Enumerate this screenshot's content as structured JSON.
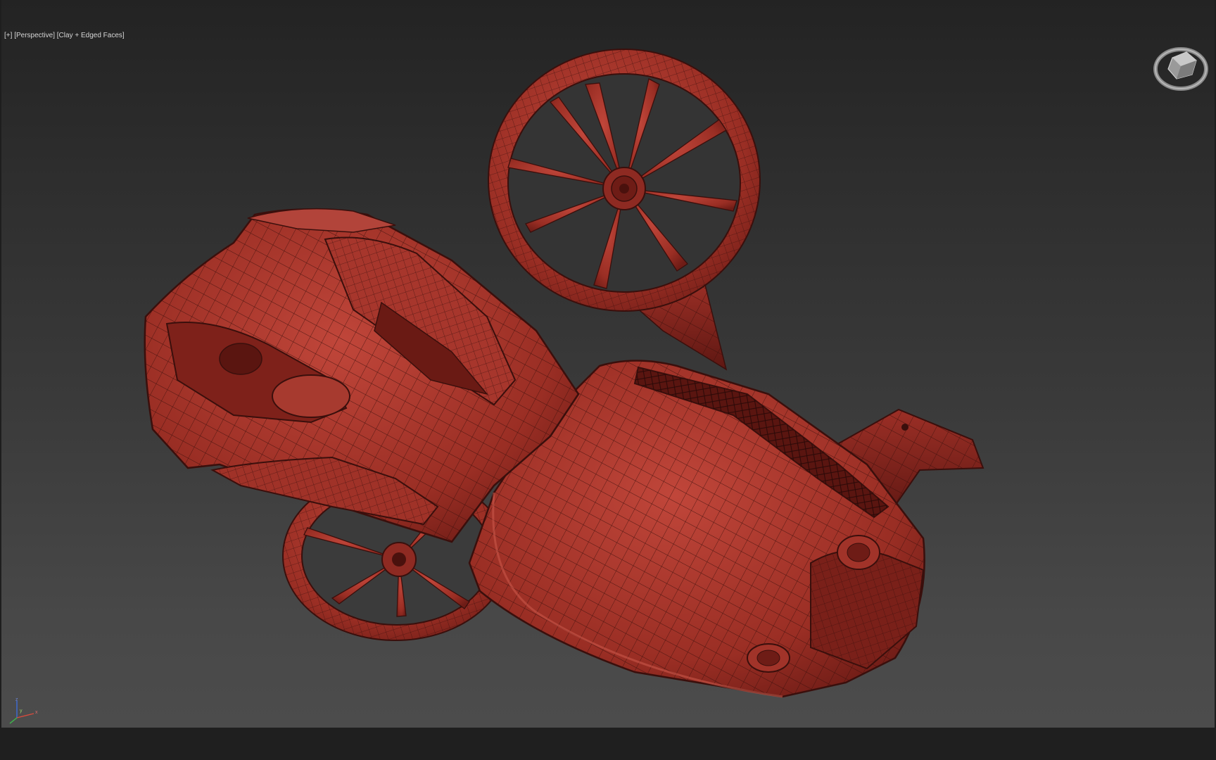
{
  "viewport": {
    "label": {
      "plus": "[+]",
      "view": "[Perspective]",
      "shading": "[Clay + Edged Faces]"
    },
    "view_mode": "Perspective",
    "shading_mode": "Clay + Edged Faces",
    "model_color": "#a8342a",
    "edge_color": "#3a0f0c",
    "background_top": "#232323",
    "background_bottom": "#4c4c4c"
  },
  "viewcube": {
    "icon": "viewcube-icon"
  },
  "axis_gizmo": {
    "labels": [
      "z",
      "y",
      "x"
    ]
  }
}
